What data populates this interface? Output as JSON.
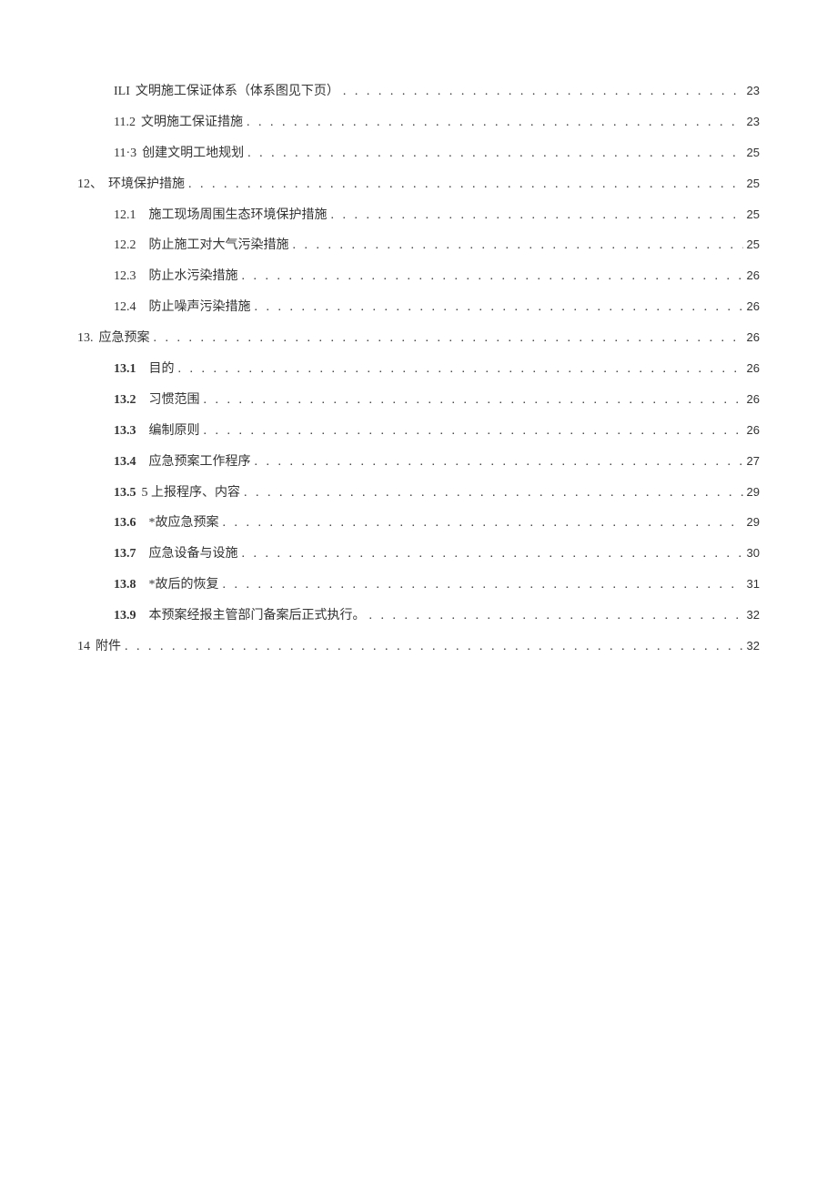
{
  "toc": {
    "entries": [
      {
        "level": 2,
        "num": "ILI",
        "num_bold": false,
        "num_gap": false,
        "title": "文明施工保证体系（体系图见下页）",
        "page": "23"
      },
      {
        "level": 2,
        "num": "11.2",
        "num_bold": false,
        "num_gap": false,
        "title": "文明施工保证措施",
        "page": "23"
      },
      {
        "level": 2,
        "num": "11·3",
        "num_bold": false,
        "num_gap": false,
        "title": "创建文明工地规划",
        "page": "25"
      },
      {
        "level": 1,
        "num": "12、",
        "num_bold": false,
        "num_gap": false,
        "title": "环境保护措施",
        "page": "25"
      },
      {
        "level": 3,
        "num": "12.1",
        "num_bold": false,
        "num_gap": true,
        "title": "施工现场周围生态环境保护措施",
        "page": "25"
      },
      {
        "level": 3,
        "num": "12.2",
        "num_bold": false,
        "num_gap": true,
        "title": "防止施工对大气污染措施",
        "page": "25"
      },
      {
        "level": 3,
        "num": "12.3",
        "num_bold": false,
        "num_gap": true,
        "title": "防止水污染措施",
        "page": "26"
      },
      {
        "level": 3,
        "num": "12.4",
        "num_bold": false,
        "num_gap": true,
        "title": "防止噪声污染措施",
        "page": "26"
      },
      {
        "level": 1,
        "num": "13.",
        "num_bold": false,
        "num_gap": false,
        "title": "应急预案",
        "page": "26"
      },
      {
        "level": 2,
        "num": "13.1",
        "num_bold": true,
        "num_gap": true,
        "title": "目的",
        "page": "26"
      },
      {
        "level": 2,
        "num": "13.2",
        "num_bold": true,
        "num_gap": true,
        "title": "习惯范围",
        "page": "26"
      },
      {
        "level": 2,
        "num": "13.3",
        "num_bold": true,
        "num_gap": true,
        "title": "编制原则",
        "page": "26"
      },
      {
        "level": 2,
        "num": "13.4",
        "num_bold": true,
        "num_gap": true,
        "title": "应急预案工作程序",
        "page": "27"
      },
      {
        "level": 2,
        "num": "13.5",
        "num_bold": true,
        "num_gap": false,
        "title": "5 上报程序、内容",
        "page": "29"
      },
      {
        "level": 2,
        "num": "13.6",
        "num_bold": true,
        "num_gap": true,
        "title": "*故应急预案",
        "page": "29"
      },
      {
        "level": 2,
        "num": "13.7",
        "num_bold": true,
        "num_gap": true,
        "title": "应急设备与设施",
        "page": "30"
      },
      {
        "level": 2,
        "num": "13.8",
        "num_bold": true,
        "num_gap": true,
        "title": "*故后的恢复",
        "page": "31"
      },
      {
        "level": 2,
        "num": "13.9",
        "num_bold": true,
        "num_gap": true,
        "title": "本预案经报主管部门备案后正式执行。",
        "page": "32"
      },
      {
        "level": 1,
        "num": "14",
        "num_bold": false,
        "num_gap": false,
        "title": "附件",
        "page": "32"
      }
    ]
  },
  "dots": ". . . . . . . . . . . . . . . . . . . . . . . . . . . . . . . . . . . . . . . . . . . . . . . . . . . . . . . . . . . . . . . . . . . . . . . . . . . . . . . . . . . . . . . . . . . . . . . . . . . . . . . . . . . . . . . . . . . . . . . ."
}
